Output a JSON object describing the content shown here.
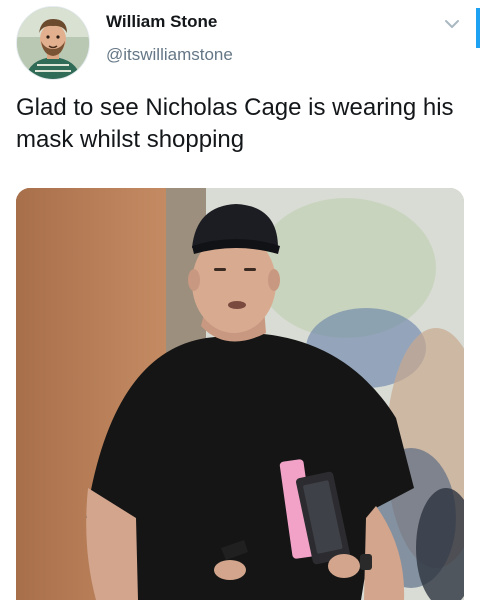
{
  "tweet": {
    "author_name": "William Stone",
    "author_handle": "@itswilliamstone",
    "text": "Glad to see Nicholas Cage is wearing his mask whilst shopping",
    "avatar_icon": "user-avatar-photo",
    "menu_icon": "chevron-down-icon",
    "media_alt": "photo-man-black-cap-black-tshirt"
  },
  "colors": {
    "accent": "#1da1f2",
    "name_text": "#14171a",
    "handle_text": "#657786"
  }
}
